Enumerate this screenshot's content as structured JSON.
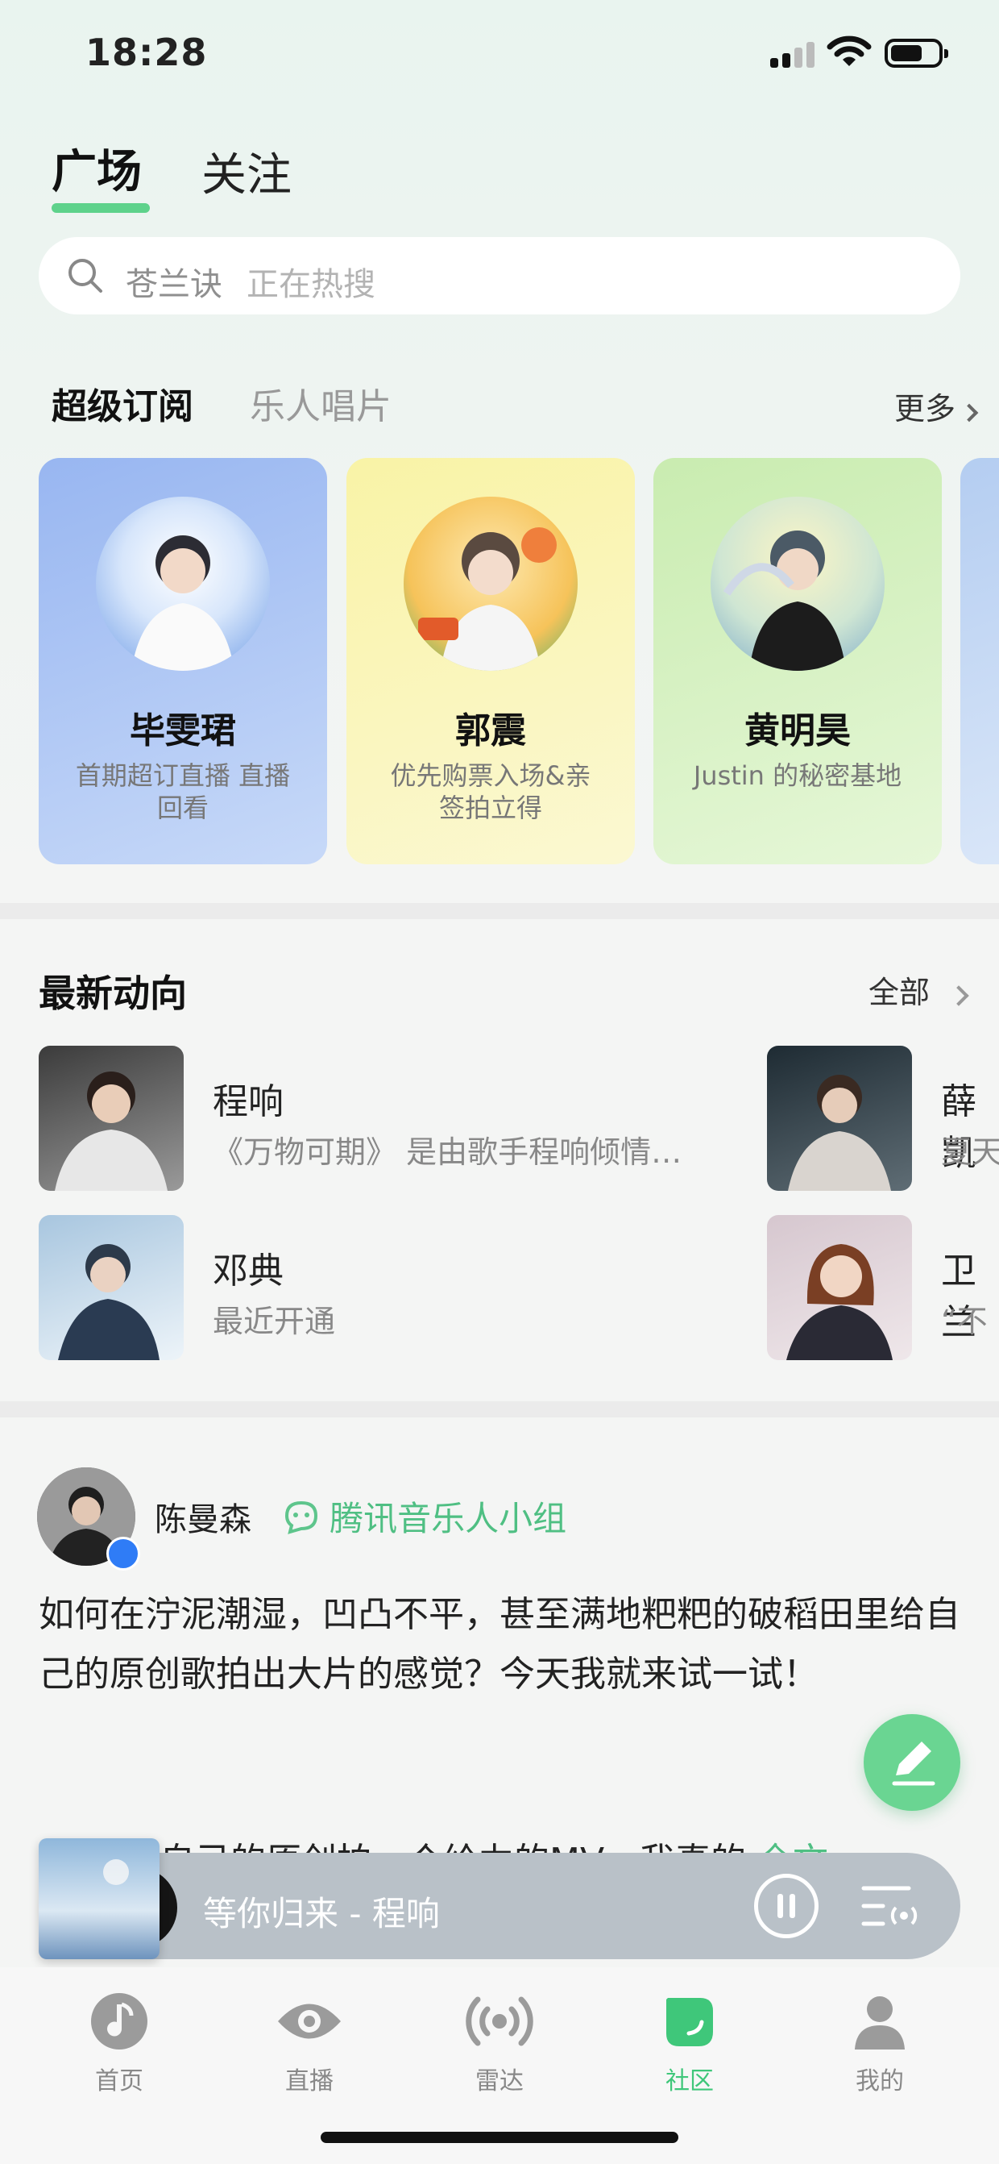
{
  "status_bar": {
    "time": "18:28"
  },
  "top_tabs": [
    {
      "label": "广场",
      "active": true
    },
    {
      "label": "关注",
      "active": false
    }
  ],
  "search": {
    "keyword": "苍兰诀",
    "hint": "正在热搜"
  },
  "subscribe": {
    "tabs": [
      "超级订阅",
      "乐人唱片"
    ],
    "more": "更多",
    "cards": [
      {
        "name": "毕雯珺",
        "desc": "首期超订直播 直播回看",
        "color": "#a8c3f3"
      },
      {
        "name": "郭震",
        "desc": "优先购票入场&亲签拍立得",
        "color": "#f7f1b0"
      },
      {
        "name": "黄明昊",
        "desc": "Justin 的秘密基地",
        "color": "#d5f0c2"
      }
    ]
  },
  "latest": {
    "title": "最新动向",
    "all": "全部",
    "items": [
      {
        "name": "程响",
        "desc": "《万物可期》 是由歌手程响倾情…"
      },
      {
        "name": "薛凯",
        "desc": "夏天"
      },
      {
        "name": "邓典",
        "desc": "最近开通"
      },
      {
        "name": "卫兰",
        "desc": "“不"
      }
    ]
  },
  "post": {
    "author": "陈曼森",
    "group": "腾讯音乐人小组",
    "text": "如何在泞泥潮湿，凹凸不平，甚至满地粑粑的破稻田里给自己的原创歌拍出大片的感觉？今天我就来试一试！",
    "text2_partial": "自己的原创拍一个给力的MV，我真的",
    "text2_link": "全文"
  },
  "player": {
    "track": "等你归来 - 程响"
  },
  "nav": [
    {
      "label": "首页",
      "icon": "music-note-icon",
      "active": false
    },
    {
      "label": "直播",
      "icon": "eye-icon",
      "active": false
    },
    {
      "label": "雷达",
      "icon": "radar-icon",
      "active": false
    },
    {
      "label": "社区",
      "icon": "community-icon",
      "active": true
    },
    {
      "label": "我的",
      "icon": "user-icon",
      "active": false
    }
  ],
  "colors": {
    "accent": "#5ed28b",
    "active_nav": "#3fc77a"
  }
}
